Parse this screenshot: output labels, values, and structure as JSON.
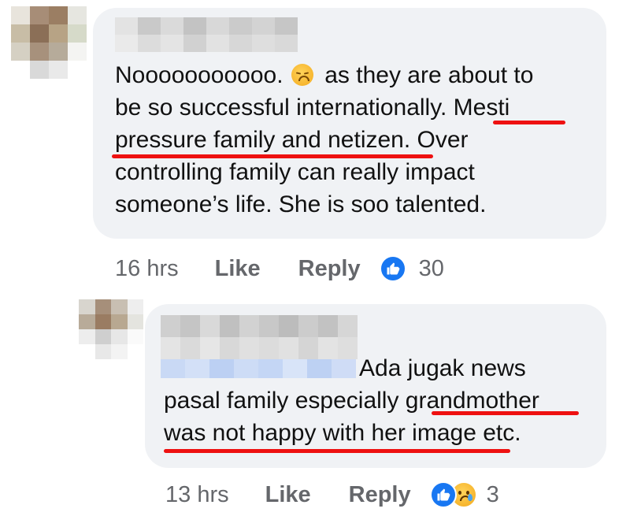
{
  "comment1": {
    "avatar_icon": "blurred-profile-photo",
    "name_redacted": true,
    "text_lines": [
      {
        "before_emoji": "Nooooooooooo.",
        "after_emoji": "as they are about to"
      },
      {
        "text": "be so successful internationally.  Mesti"
      },
      {
        "text": "pressure family and netizen. Over"
      },
      {
        "text": "controlling family can really impact"
      },
      {
        "text": "someone’s life. She is soo talented."
      }
    ],
    "emoji": "disappointed-face-emoji",
    "underline_color": "#ee1111",
    "time": "16 hrs",
    "like_label": "Like",
    "reply_label": "Reply",
    "reaction_icons": [
      "like-reaction-icon"
    ],
    "reaction_count": "30"
  },
  "comment2": {
    "avatar_icon": "blurred-profile-photo",
    "name_redacted": true,
    "text_lines": [
      {
        "text": "Ada jugak news"
      },
      {
        "text": "pasal family especially grandmother"
      },
      {
        "text": "was not happy with her image etc."
      }
    ],
    "time": "13 hrs",
    "like_label": "Like",
    "reply_label": "Reply",
    "reaction_icons": [
      "like-reaction-icon",
      "sad-reaction-icon"
    ],
    "reaction_count": "3"
  },
  "colors": {
    "bubble": "#f0f2f5",
    "facebook_blue": "#1877f2",
    "meta_text": "#65676b",
    "underline": "#ee1111"
  }
}
